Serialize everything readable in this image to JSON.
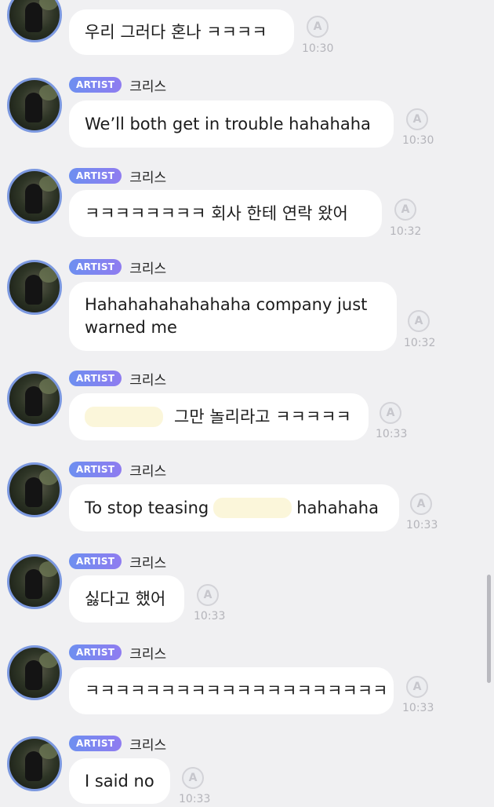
{
  "chat": {
    "messages": [
      {
        "badge": "",
        "sender": "",
        "text": "우리 그러다 혼나 ㅋㅋㅋㅋ",
        "read_icon": "A",
        "time": "10:30"
      },
      {
        "badge": "ARTIST",
        "sender": "크리스",
        "text": "We’ll both get in trouble hahahaha",
        "read_icon": "A",
        "time": "10:30"
      },
      {
        "badge": "ARTIST",
        "sender": "크리스",
        "text": "ㅋㅋㅋㅋㅋㅋㅋㅋ 회사 한테 연락 왔어",
        "read_icon": "A",
        "time": "10:32"
      },
      {
        "badge": "ARTIST",
        "sender": "크리스",
        "text": "Hahahahahahahaha company just warned me",
        "read_icon": "A",
        "time": "10:32"
      },
      {
        "badge": "ARTIST",
        "sender": "크리스",
        "text": "그만 놀리라고 ㅋㅋㅋㅋㅋ",
        "read_icon": "A",
        "time": "10:33"
      },
      {
        "badge": "ARTIST",
        "sender": "크리스",
        "text_before": "To stop teasing",
        "text_after": "hahahaha",
        "read_icon": "A",
        "time": "10:33"
      },
      {
        "badge": "ARTIST",
        "sender": "크리스",
        "text": "싫다고 했어",
        "read_icon": "A",
        "time": "10:33"
      },
      {
        "badge": "ARTIST",
        "sender": "크리스",
        "text": "ㅋㅋㅋㅋㅋㅋㅋㅋㅋㅋㅋㅋㅋㅋㅋㅋㅋㅋㅋㅋ",
        "read_icon": "A",
        "time": "10:33"
      },
      {
        "badge": "ARTIST",
        "sender": "크리스",
        "text": "I said no",
        "read_icon": "A",
        "time": "10:33"
      }
    ]
  }
}
